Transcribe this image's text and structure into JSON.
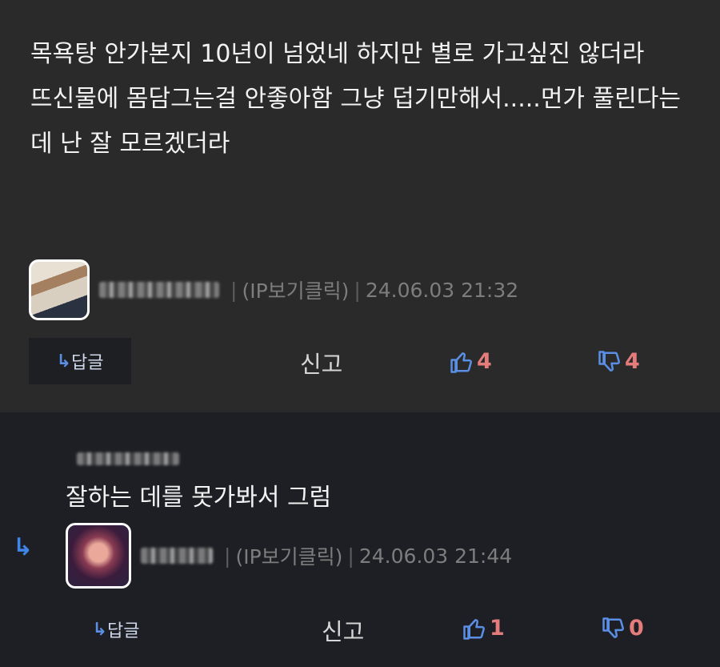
{
  "comments": [
    {
      "paragraphs": [
        "목욕탕 안가본지 10년이 넘었네 하지만 별로 가고싶진 않더라",
        "",
        "뜨신물에 몸담그는걸 안좋아함 그냥 덥기만해서.....먼가 풀린다는데 난 잘 모르겠더라"
      ],
      "ip_label": "(IP보기클릭)",
      "timestamp": "24.06.03 21:32",
      "reply_label": "답글",
      "report_label": "신고",
      "upvotes": "4",
      "downvotes": "4"
    },
    {
      "text": "잘하는 데를 못가봐서 그럼",
      "ip_label": "(IP보기클릭)",
      "timestamp": "24.06.03 21:44",
      "reply_label": "답글",
      "report_label": "신고",
      "upvotes": "1",
      "downvotes": "0"
    }
  ],
  "colors": {
    "accent": "#5b8fe6",
    "vote_count": "#e57c7c",
    "top_bg": "#2a2a2a",
    "reply_bg": "#1d1f24"
  },
  "icons": {
    "reply": "reply-arrow-icon",
    "up": "thumbs-up-icon",
    "down": "thumbs-down-icon"
  }
}
